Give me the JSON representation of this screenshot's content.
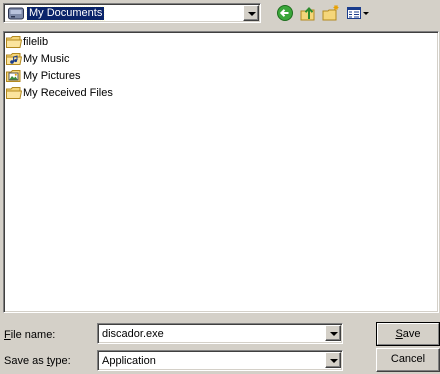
{
  "look_in": {
    "value": "My Documents",
    "icon": "my-documents-drive-icon"
  },
  "toolbar": {
    "back_icon": "back-arrow-icon",
    "up_icon": "up-folder-icon",
    "new_folder_icon": "new-folder-icon",
    "view_icon": "view-menu-icon"
  },
  "files": [
    {
      "name": "filelib",
      "icon": "folder-icon"
    },
    {
      "name": "My Music",
      "icon": "music-folder-icon"
    },
    {
      "name": "My Pictures",
      "icon": "pictures-folder-icon"
    },
    {
      "name": "My Received Files",
      "icon": "folder-icon"
    }
  ],
  "form": {
    "filename_label": "ile name:",
    "filename_label_mnemonic": "F",
    "filename_value": "discador.exe",
    "type_label_pre": "Save as ",
    "type_label_mnemonic": "t",
    "type_label_post": "ype:",
    "type_value": "Application"
  },
  "buttons": {
    "save_mnemonic": "S",
    "save_rest": "ave",
    "cancel": "Cancel"
  },
  "colors": {
    "face": "#d4d0c8",
    "selection": "#0a246a",
    "folder": "#f5d67a",
    "back_green": "#3aa63a"
  }
}
